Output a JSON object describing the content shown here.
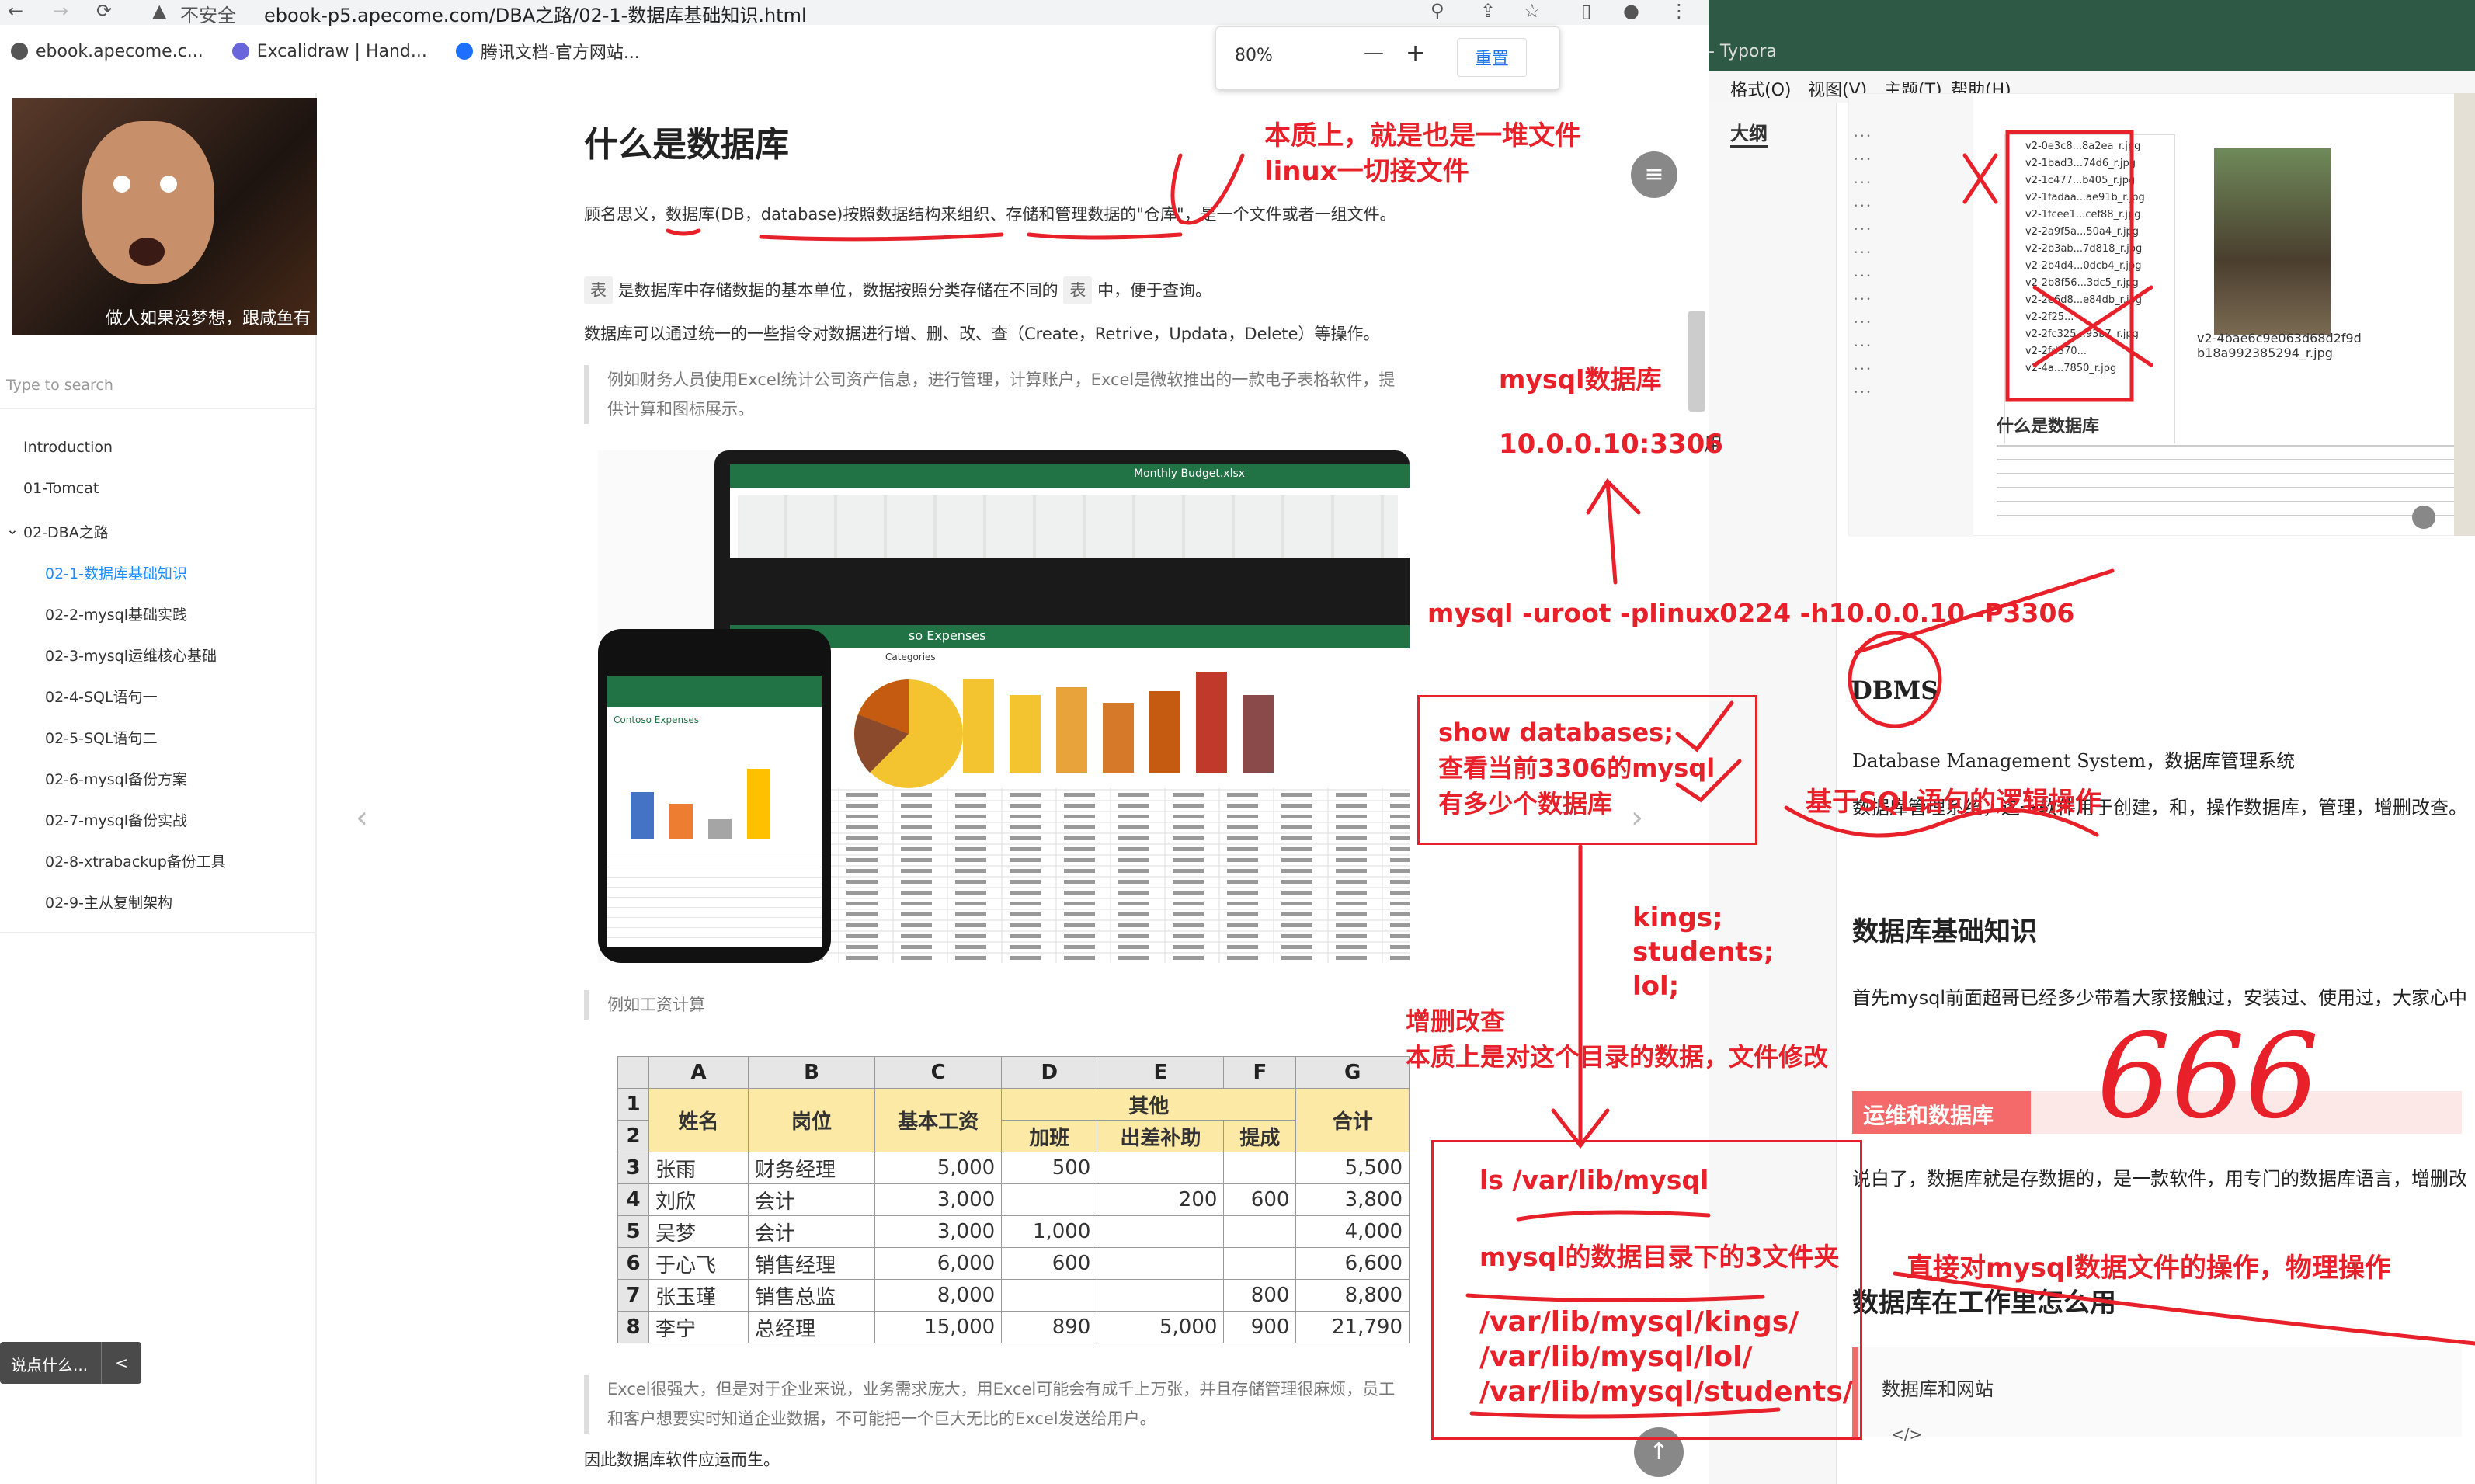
{
  "browser": {
    "security": "不安全",
    "url": "ebook-p5.apecome.com/DBA之路/02-1-数据库基础知识.html",
    "bookmarks": [
      "ebook.apecome.c...",
      "Excalidraw | Hand...",
      "腾讯文档-官方网站..."
    ],
    "zoom": {
      "value": "80%",
      "minus": "—",
      "plus": "+",
      "reset": "重置"
    }
  },
  "sidebar": {
    "cover_caption": "做人如果没梦想，跟咸鱼有",
    "search_placeholder": "Type to search",
    "items": [
      {
        "label": "Introduction"
      },
      {
        "label": "01-Tomcat"
      },
      {
        "label": "02-DBA之路"
      },
      {
        "label": "02-1-数据库基础知识"
      },
      {
        "label": "02-2-mysql基础实践"
      },
      {
        "label": "02-3-mysql运维核心基础"
      },
      {
        "label": "02-4-SQL语句一"
      },
      {
        "label": "02-5-SQL语句二"
      },
      {
        "label": "02-6-mysql备份方案"
      },
      {
        "label": "02-7-mysql备份实战"
      },
      {
        "label": "02-8-xtrabackup备份工具"
      },
      {
        "label": "02-9-主从复制架构"
      }
    ],
    "chat_placeholder": "说点什么...",
    "chat_toggle": "<"
  },
  "article": {
    "title": "什么是数据库",
    "p1": "顾名思义，数据库(DB，database)按照数据结构来组织、存储和管理数据的\"仓库\"，是一个文件或者一组文件。",
    "p2_tag": "表",
    "p2_a": "是数据库中存储数据的基本单位，数据按照分类存储在不同的",
    "p2_b": "中，便于查询。",
    "p3": "数据库可以通过统一的一些指令对数据进行增、删、改、查（Create，Retrive，Updata，Delete）等操作。",
    "quote1": "例如财务人员使用Excel统计公司资产信息，进行管理，计算账户，Excel是微软推出的一款电子表格软件，提供计算和图标展示。",
    "excel_sheet_title": "Monthly Budget.xlsx",
    "phone_title": "Contoso Expenses",
    "chart_title": "Categories",
    "expenses_label": "so Expenses",
    "quote2": "例如工资计算",
    "quote3": "Excel很强大，但是对于企业来说，业务需求庞大，用Excel可能会有成千上万张，并且存储管理很麻烦，员工和客户想要实时知道企业数据，不可能把一个巨大无比的Excel发送给用户。",
    "p4": "因此数据库软件应运而生。"
  },
  "salary_table": {
    "col_letters": [
      "A",
      "B",
      "C",
      "D",
      "E",
      "F",
      "G"
    ],
    "headers": {
      "name": "姓名",
      "post": "岗位",
      "base": "基本工资",
      "other": "其他",
      "overtime": "加班",
      "travel": "出差补助",
      "commission": "提成",
      "total": "合计"
    },
    "rows": [
      {
        "no": "3",
        "name": "张雨",
        "post": "财务经理",
        "base": "5,000",
        "overtime": "500",
        "travel": "",
        "commission": "",
        "total": "5,500"
      },
      {
        "no": "4",
        "name": "刘欣",
        "post": "会计",
        "base": "3,000",
        "overtime": "",
        "travel": "200",
        "commission": "600",
        "total": "3,800"
      },
      {
        "no": "5",
        "name": "吴梦",
        "post": "会计",
        "base": "3,000",
        "overtime": "1,000",
        "travel": "",
        "commission": "",
        "total": "4,000"
      },
      {
        "no": "6",
        "name": "于心飞",
        "post": "销售经理",
        "base": "6,000",
        "overtime": "600",
        "travel": "",
        "commission": "",
        "total": "6,600"
      },
      {
        "no": "7",
        "name": "张玉瑾",
        "post": "销售总监",
        "base": "8,000",
        "overtime": "",
        "travel": "",
        "commission": "800",
        "total": "8,800"
      },
      {
        "no": "8",
        "name": "李宁",
        "post": "总经理",
        "base": "15,000",
        "overtime": "890",
        "travel": "5,000",
        "commission": "900",
        "total": "21,790"
      }
    ]
  },
  "annotations": {
    "essence_1": "本质上，就是也是一堆文件",
    "essence_2": "linux一切接文件",
    "mysql_db": "mysql数据库",
    "address": "10.0.0.10:3306",
    "login_cmd": "mysql -uroot -plinux0224 -h10.0.0.10 -P3306",
    "show_db_1": "show databases;",
    "show_db_2": "查看当前3306的mysql",
    "show_db_3": "有多少个数据库",
    "dbs_1": "kings;",
    "dbs_2": "students;",
    "dbs_3": "lol;",
    "crud_1": "增删改查",
    "crud_2": "本质上是对这个目录的数据，文件修改",
    "ls_cmd": "ls /var/lib/mysql",
    "three_dirs": "mysql的数据目录下的3文件夹",
    "dir1": "/var/lib/mysql/kings/",
    "dir2": "/var/lib/mysql/lol/",
    "dir3": "/var/lib/mysql/students/",
    "sql_logic": "基于SQL语句的逻辑操作",
    "direct_op": "直接对mysql数据文件的操作，物理操作",
    "handwritten": "666"
  },
  "typora": {
    "title": "- Typora",
    "menu": [
      "格式(O)",
      "视图(V)",
      "主题(T)",
      "帮助(H)"
    ],
    "outline_label": "大纲",
    "thumb_files": [
      "v2-0e3c8...8a2ea_r.jpg",
      "v2-1bad3...74d6_r.jpg",
      "v2-1c477...b405_r.jpg",
      "v2-1fadaa...ae91b_r.jpg",
      "v2-1fcee1...cef88_r.jpg",
      "v2-2a9f5a...50a4_r.jpg",
      "v2-2b3ab...7d818_r.jpg",
      "v2-2b4d4...0dcb4_r.jpg",
      "v2-2b8f56...3dc5_r.jpg",
      "v2-2e6d8...e84db_r.jpg",
      "v2-2f25...",
      "v2-2fc325...93b7_r.jpg",
      "v2-2fd370...",
      "v2-4a...7850_r.jpg"
    ],
    "thumb_caption": "v2-4bae6c9e063d68d2f9d b18a992385294_r.jpg",
    "thumb_heading": "什么是数据库",
    "dbms": "DBMS",
    "dbms_full": "Database Management System，数据库管理系统",
    "dbms_desc": "数据库管理系统，这一软件用于创建，和，操作数据库，管理，增删改查。",
    "h_basic": "数据库基础知识",
    "basic_desc": "首先mysql前面超哥已经多少带着大家接触过，安装过、使用过，大家心中",
    "sec_tag": "运维和数据库",
    "sec_desc": "说白了，数据库就是存数据的，是一款软件，用专门的数据库语言，增删改",
    "h_work": "数据库在工作里怎么用",
    "web": "数据库和网站",
    "code_toggle": "</>",
    "partial_use": "用"
  }
}
